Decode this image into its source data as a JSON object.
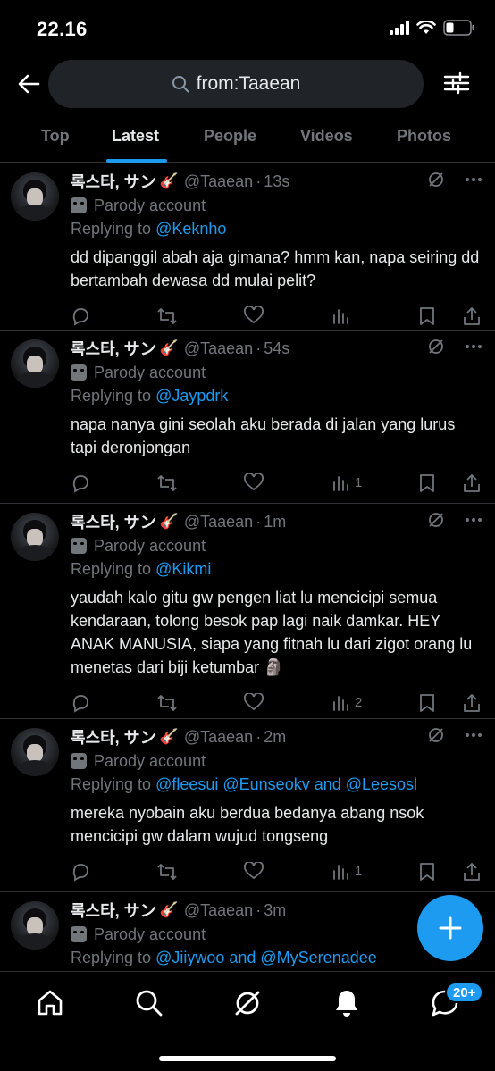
{
  "status_bar": {
    "time": "22.16"
  },
  "search": {
    "query": "from:Taaean"
  },
  "tabs": [
    {
      "label": "Top",
      "active": false
    },
    {
      "label": "Latest",
      "active": true
    },
    {
      "label": "People",
      "active": false
    },
    {
      "label": "Videos",
      "active": false
    },
    {
      "label": "Photos",
      "active": false
    }
  ],
  "colors": {
    "accent": "#1d9bf0",
    "background": "#000000",
    "muted": "#71767b",
    "text": "#e7e9ea"
  },
  "tweets": [
    {
      "display_name": "록스타, サン",
      "emoji": "🎸",
      "handle": "@Taaean",
      "time": "13s",
      "parody_label": "Parody account",
      "replying_prefix": "Replying to",
      "replying_to": "@Keknho",
      "text": "dd dipanggil abah aja gimana? hmm kan, napa seiring dd bertambah dewasa dd mulai pelit?",
      "views": ""
    },
    {
      "display_name": "록스타, サン",
      "emoji": "🎸",
      "handle": "@Taaean",
      "time": "54s",
      "parody_label": "Parody account",
      "replying_prefix": "Replying to",
      "replying_to": "@Jaypdrk",
      "text": "napa nanya gini seolah aku berada di jalan yang lurus tapi deronjongan",
      "views": "1"
    },
    {
      "display_name": "록스타, サン",
      "emoji": "🎸",
      "handle": "@Taaean",
      "time": "1m",
      "parody_label": "Parody account",
      "replying_prefix": "Replying to",
      "replying_to": "@Kikmi",
      "text": "yaudah kalo gitu gw pengen liat lu mencicipi semua kendaraan, tolong besok pap lagi naik damkar. HEY ANAK MANUSIA, siapa yang fitnah lu dari zigot orang lu menetas dari biji ketumbar 🗿",
      "views": "2"
    },
    {
      "display_name": "록스타, サン",
      "emoji": "🎸",
      "handle": "@Taaean",
      "time": "2m",
      "parody_label": "Parody account",
      "replying_prefix": "Replying to",
      "replying_to": "@fleesui @Eunseokv and @Leesosl",
      "text": "mereka nyobain aku berdua bedanya abang nsok mencicipi gw dalam wujud tongseng",
      "views": "1"
    },
    {
      "display_name": "록스타, サン",
      "emoji": "🎸",
      "handle": "@Taaean",
      "time": "3m",
      "parody_label": "Parody account",
      "replying_prefix": "Replying to",
      "replying_to": "@Jiiywoo and @MySerenadee",
      "text": "",
      "views": ""
    }
  ],
  "bottom_nav": {
    "items": [
      "home-icon",
      "search-icon",
      "grok-icon",
      "notifications-icon",
      "messages-icon"
    ],
    "messages_badge": "20+"
  }
}
